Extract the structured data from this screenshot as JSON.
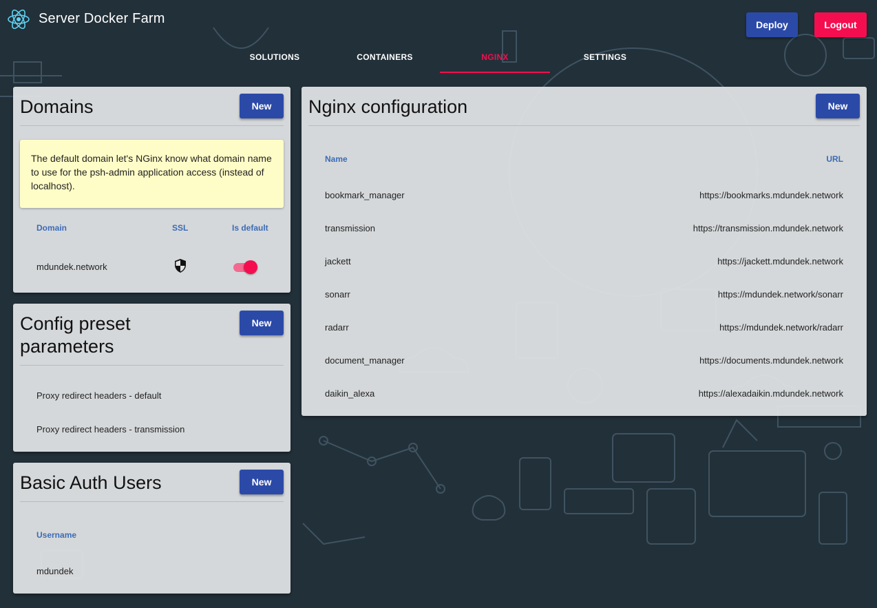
{
  "app": {
    "title": "Server Docker Farm",
    "logo_icon": "react-atom-icon",
    "accent_color": "#f50e4f",
    "primary_color": "#2b4aa8"
  },
  "header": {
    "deploy_label": "Deploy",
    "logout_label": "Logout"
  },
  "tabs": [
    {
      "label": "SOLUTIONS",
      "active": false
    },
    {
      "label": "CONTAINERS",
      "active": false
    },
    {
      "label": "NGINX",
      "active": true
    },
    {
      "label": "SETTINGS",
      "active": false
    }
  ],
  "domains": {
    "title": "Domains",
    "new_label": "New",
    "info": "The default domain let's NGinx know what domain name to use for the psh-admin application access (instead of localhost).",
    "columns": {
      "domain": "Domain",
      "ssl": "SSL",
      "is_default": "Is default"
    },
    "rows": [
      {
        "domain": "mdundek.network",
        "ssl_icon": "shield-icon",
        "is_default": true
      }
    ]
  },
  "config_presets": {
    "title": "Config preset parameters",
    "new_label": "New",
    "items": [
      "Proxy redirect headers - default",
      "Proxy redirect headers - transmission"
    ]
  },
  "basic_auth": {
    "title": "Basic Auth Users",
    "new_label": "New",
    "columns": {
      "username": "Username"
    },
    "rows": [
      "mdundek"
    ]
  },
  "nginx": {
    "title": "Nginx configuration",
    "new_label": "New",
    "columns": {
      "name": "Name",
      "url": "URL"
    },
    "rows": [
      {
        "name": "bookmark_manager",
        "url": "https://bookmarks.mdundek.network"
      },
      {
        "name": "transmission",
        "url": "https://transmission.mdundek.network"
      },
      {
        "name": "jackett",
        "url": "https://jackett.mdundek.network"
      },
      {
        "name": "sonarr",
        "url": "https://mdundek.network/sonarr"
      },
      {
        "name": "radarr",
        "url": "https://mdundek.network/radarr"
      },
      {
        "name": "document_manager",
        "url": "https://documents.mdundek.network"
      },
      {
        "name": "daikin_alexa",
        "url": "https://alexadaikin.mdundek.network"
      }
    ]
  }
}
